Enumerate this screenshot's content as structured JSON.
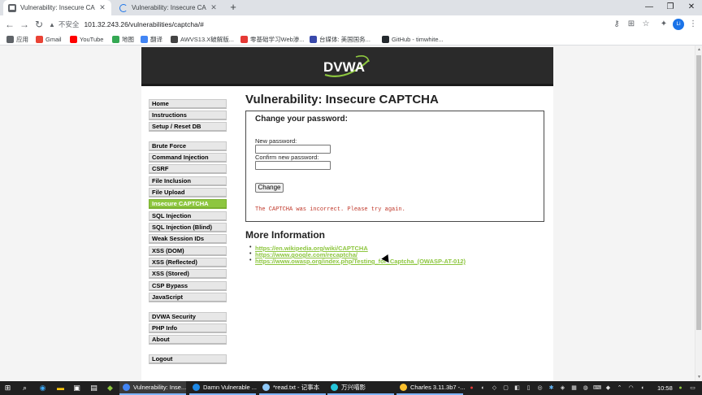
{
  "browser": {
    "tabs": [
      {
        "title": "Vulnerability: Insecure CAPTCH",
        "active": true
      },
      {
        "title": "Vulnerability: Insecure CAPTCH",
        "active": false
      }
    ],
    "newtab": "+",
    "window_controls": {
      "minimize": "—",
      "maximize": "❐",
      "close": "✕"
    },
    "omnibox": {
      "insecure_label": "不安全",
      "url": "101.32.243.26/vulnerabilities/captcha/#"
    },
    "profile_initial": "Li",
    "bookmarks": [
      {
        "label": "应用",
        "color": "#5f6368"
      },
      {
        "label": "Gmail",
        "color": "#ea4335"
      },
      {
        "label": "YouTube",
        "color": "#ff0000"
      },
      {
        "label": "地图",
        "color": "#34a853"
      },
      {
        "label": "翻译",
        "color": "#4285f4"
      },
      {
        "label": "AWVS13.X破解版...",
        "color": "#444444"
      },
      {
        "label": "零基础学习Web渗...",
        "color": "#e53935"
      },
      {
        "label": "台媒体: 美国国务...",
        "color": "#3949ab"
      },
      {
        "label": "GitHub - timwhite...",
        "color": "#24292e"
      }
    ]
  },
  "dvwa": {
    "menu": {
      "group1": [
        "Home",
        "Instructions",
        "Setup / Reset DB"
      ],
      "group2": [
        "Brute Force",
        "Command Injection",
        "CSRF",
        "File Inclusion",
        "File Upload",
        "Insecure CAPTCHA",
        "SQL Injection",
        "SQL Injection (Blind)",
        "Weak Session IDs",
        "XSS (DOM)",
        "XSS (Reflected)",
        "XSS (Stored)",
        "CSP Bypass",
        "JavaScript"
      ],
      "group3": [
        "DVWA Security",
        "PHP Info",
        "About"
      ],
      "group4": [
        "Logout"
      ],
      "selected": "Insecure CAPTCHA"
    },
    "page_title": "Vulnerability: Insecure CAPTCHA",
    "form": {
      "heading": "Change your password:",
      "new_password_label": "New password:",
      "confirm_password_label": "Confirm new password:",
      "new_password_value": "",
      "confirm_password_value": "",
      "submit_label": "Change"
    },
    "error_message": "The CAPTCHA was incorrect. Please try again.",
    "more_info_title": "More Information",
    "links": [
      "https://en.wikipedia.org/wiki/CAPTCHA",
      "https://www.google.com/recaptcha/",
      "https://www.owasp.org/index.php/Testing_for_Captcha_(OWASP-AT-012)"
    ]
  },
  "taskbar": {
    "apps": [
      {
        "label": "Vulnerability: Inse...",
        "color": "#4285f4",
        "active": true
      },
      {
        "label": "Damn Vulnerable ...",
        "color": "#1e88e5",
        "active": false
      },
      {
        "label": "*read.txt - 记事本",
        "color": "#90caf9",
        "active": false
      },
      {
        "label": "万兴喵影",
        "color": "#26c6da",
        "active": false
      },
      {
        "label": "Charles 3.11.3b7 -...",
        "color": "#fbc02d",
        "active": false
      }
    ],
    "time": "10:58",
    "colors": {
      "accent": "#8dc63f",
      "error": "#c0392b"
    }
  }
}
